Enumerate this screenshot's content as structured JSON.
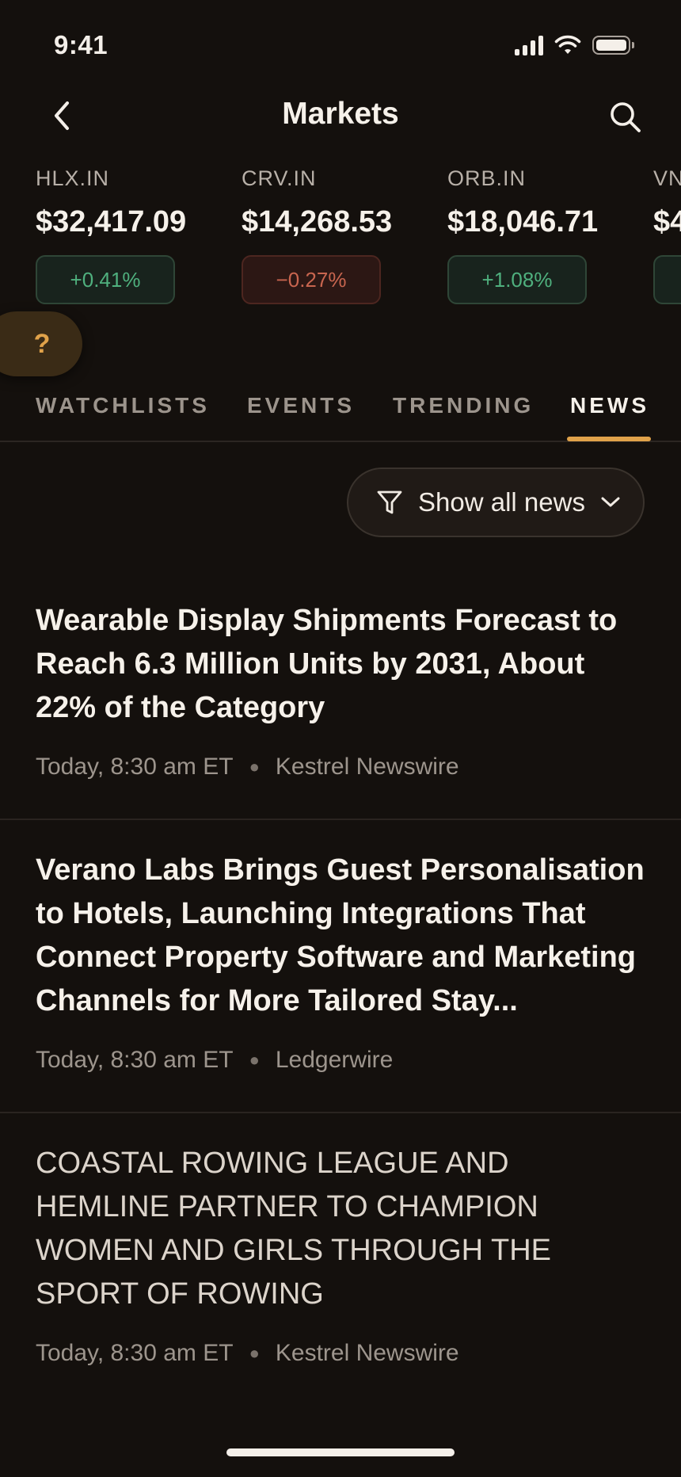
{
  "status": {
    "time": "9:41"
  },
  "nav": {
    "title": "Markets"
  },
  "tickers": [
    {
      "symbol": "HLX.IN",
      "price": "$32,417.09",
      "change": "+0.41%",
      "direction": "up"
    },
    {
      "symbol": "CRV.IN",
      "price": "$14,268.53",
      "change": "−0.27%",
      "direction": "down"
    },
    {
      "symbol": "ORB.IN",
      "price": "$18,046.71",
      "change": "+1.08%",
      "direction": "up"
    },
    {
      "symbol": "VN",
      "price": "$4",
      "change": "",
      "direction": "up"
    }
  ],
  "help": {
    "label": "?"
  },
  "tabs": [
    {
      "label": "WATCHLISTS",
      "active": false
    },
    {
      "label": "EVENTS",
      "active": false
    },
    {
      "label": "TRENDING",
      "active": false
    },
    {
      "label": "NEWS",
      "active": true
    }
  ],
  "filter": {
    "label": "Show all news"
  },
  "news": [
    {
      "headline": "Wearable Display Shipments Forecast to Reach 6.3 Million Units by 2031, About 22% of the Category",
      "time": "Today, 8:30 am ET",
      "source": "Kestrel Newswire"
    },
    {
      "headline": "Verano Labs Brings Guest Personalisation to Hotels, Launching Integrations That Connect Property Software and Marketing Channels for More Tailored Stay...",
      "time": "Today, 8:30 am ET",
      "source": "Ledgerwire"
    },
    {
      "headline": "COASTAL ROWING LEAGUE AND HEMLINE PARTNER TO CHAMPION WOMEN AND GIRLS THROUGH THE SPORT OF ROWING",
      "time": "Today, 8:30 am ET",
      "source": "Kestrel Newswire"
    }
  ],
  "colors": {
    "accent": "#e0a24a",
    "positive": "#4fb07e",
    "negative": "#c8654f",
    "background": "#14100d"
  }
}
